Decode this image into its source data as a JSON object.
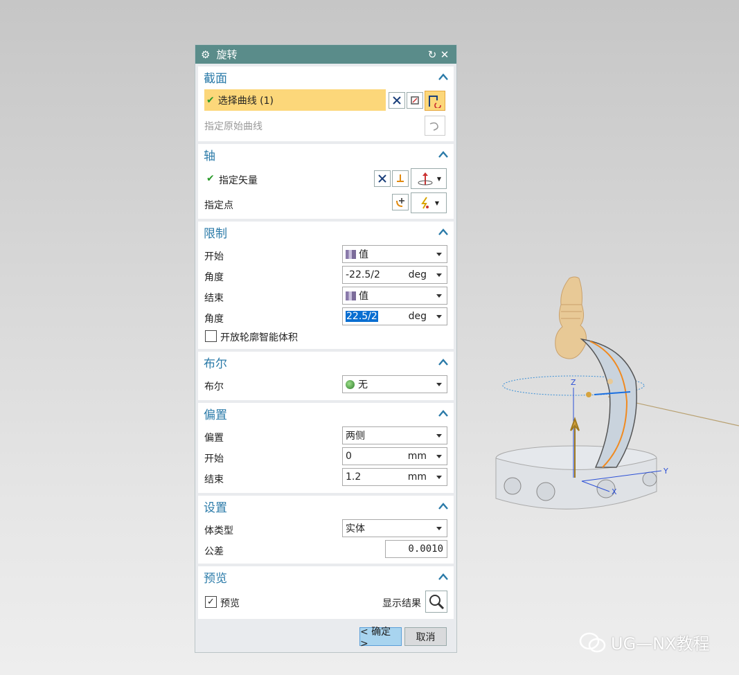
{
  "dialog": {
    "title": "旋转",
    "sections": {
      "section": {
        "title": "截面",
        "select_curve": "选择曲线 (1)",
        "specify_origin_curve": "指定原始曲线"
      },
      "axis": {
        "title": "轴",
        "specify_vector": "指定矢量",
        "specify_point": "指定点"
      },
      "limits": {
        "title": "限制",
        "start_label": "开始",
        "start_value": "值",
        "start_angle_label": "角度",
        "start_angle_value": "-22.5/2",
        "start_angle_unit": "deg",
        "end_label": "结束",
        "end_value": "值",
        "end_angle_label": "角度",
        "end_angle_value": "22.5/2",
        "end_angle_unit": "deg",
        "open_profile_label": "开放轮廓智能体积",
        "open_profile_checked": false
      },
      "boolean": {
        "title": "布尔",
        "label": "布尔",
        "value": "无"
      },
      "offset": {
        "title": "偏置",
        "offset_label": "偏置",
        "offset_value": "两侧",
        "start_label": "开始",
        "start_value": "0",
        "start_unit": "mm",
        "end_label": "结束",
        "end_value": "1.2",
        "end_unit": "mm"
      },
      "settings": {
        "title": "设置",
        "body_type_label": "体类型",
        "body_type_value": "实体",
        "tolerance_label": "公差",
        "tolerance_value": "0.0010"
      },
      "preview": {
        "title": "预览",
        "preview_label": "预览",
        "preview_checked": true,
        "show_result_label": "显示结果"
      }
    },
    "ok_label": "< 确定 >",
    "cancel_label": "取消"
  },
  "viewport": {
    "axis_labels": {
      "z": "Z",
      "y": "Y",
      "x": "X"
    }
  },
  "watermark": "UG—NX教程",
  "colors": {
    "title_bar": "#5a8c8a",
    "section_header": "#2a7aa8",
    "selected_row": "#fcd77a",
    "ok_button": "#a8d4ef"
  }
}
